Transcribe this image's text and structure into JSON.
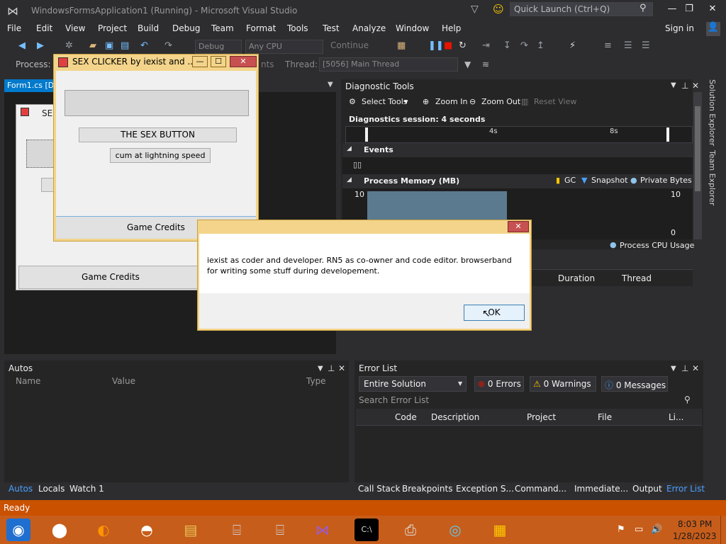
{
  "window": {
    "title": "WindowsFormsApplication1 (Running) - Microsoft Visual Studio"
  },
  "quick_launch": {
    "placeholder": "Quick Launch (Ctrl+Q)"
  },
  "menu": [
    "File",
    "Edit",
    "View",
    "Project",
    "Build",
    "Debug",
    "Team",
    "Format",
    "Tools",
    "Test",
    "Analyze",
    "Window",
    "Help"
  ],
  "signin": "Sign in",
  "toolbar": {
    "config": "Debug",
    "platform": "Any CPU",
    "continue": "Continue"
  },
  "debug_location": {
    "process_label": "Process:",
    "events_label": "nts",
    "thread_label": "Thread:",
    "thread_value": "[5056] Main Thread"
  },
  "doc_tab": "Form1.cs [De",
  "designer": {
    "title_partial": "SE",
    "credits": "Game Credits"
  },
  "diagnostic": {
    "title": "Diagnostic Tools",
    "select_tools": "Select Tools",
    "zoom_in": "Zoom In",
    "zoom_out": "Zoom Out",
    "reset_view": "Reset View",
    "session": "Diagnostics session: 4 seconds",
    "tick_4s": "4s",
    "tick_8s": "8s",
    "events": "Events",
    "process_memory": "Process Memory (MB)",
    "gc": "GC",
    "snapshot": "Snapshot",
    "private_bytes": "Private Bytes",
    "mem_left_max": "10",
    "mem_right_max": "10",
    "mem_right_min": "0",
    "process_cpu": "Process CPU Usage"
  },
  "sidebar_tabs": [
    "Solution Explorer",
    "Team Explorer"
  ],
  "output_cols": {
    "duration": "Duration",
    "thread": "Thread"
  },
  "autos": {
    "title": "Autos",
    "cols": [
      "Name",
      "Value",
      "Type"
    ]
  },
  "error_list": {
    "title": "Error List",
    "scope": "Entire Solution",
    "errors": "0 Errors",
    "warnings": "0 Warnings",
    "messages": "0 Messages",
    "search_placeholder": "Search Error List",
    "cols": [
      "Code",
      "Description",
      "Project",
      "File",
      "Li..."
    ]
  },
  "bottom_tabs_left": [
    "Autos",
    "Locals",
    "Watch 1"
  ],
  "bottom_tabs_right": [
    "Call Stack",
    "Breakpoints",
    "Exception S...",
    "Command...",
    "Immediate...",
    "Output",
    "Error List"
  ],
  "status": "Ready",
  "clock": {
    "time": "8:03 PM",
    "date": "1/28/2023"
  },
  "clicker": {
    "title": "SEX CLICKER by iexist and ...",
    "sex_button": "THE SEX BUTTON",
    "speed_button": "cum at lightning speed",
    "credits": "Game Credits"
  },
  "dialog": {
    "message": "iexist as coder and developer. RN5 as co-owner and code editor. browserband for writing some stuff during developement.",
    "ok": "OK"
  },
  "colors": {
    "accent": "#007acc",
    "status": "#ca5100",
    "dark_bg": "#2d2d30"
  }
}
